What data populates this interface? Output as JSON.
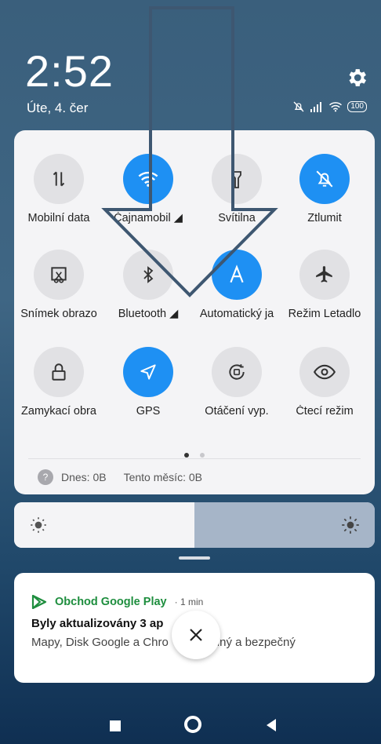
{
  "status": {
    "time": "2:52",
    "date": "Úte, 4. čer",
    "battery": "100",
    "icons": [
      "mute-icon",
      "signal-icon",
      "wifi-icon"
    ]
  },
  "quick_settings": [
    {
      "label": "Mobilní data",
      "icon": "mobile-data-icon",
      "active": false
    },
    {
      "label": "Čajnamobil ◢",
      "icon": "wifi-icon",
      "active": true
    },
    {
      "label": "Svítilna",
      "icon": "flashlight-icon",
      "active": false
    },
    {
      "label": "Ztlumit",
      "icon": "mute-icon",
      "active": true
    },
    {
      "label": "Snímek obrazo",
      "icon": "screenshot-icon",
      "active": false
    },
    {
      "label": "Bluetooth ◢",
      "icon": "bluetooth-icon",
      "active": false
    },
    {
      "label": "Automatický ja",
      "icon": "auto-brightness-icon",
      "active": true
    },
    {
      "label": "Režim Letadlo",
      "icon": "airplane-icon",
      "active": false
    },
    {
      "label": "Zamykací obra",
      "icon": "lock-icon",
      "active": false
    },
    {
      "label": "GPS",
      "icon": "location-icon",
      "active": true
    },
    {
      "label": "Otáčení vyp.",
      "icon": "rotation-icon",
      "active": false
    },
    {
      "label": "Čtecí režim",
      "icon": "eye-icon",
      "active": false
    }
  ],
  "data_usage": {
    "today": "Dnes: 0B",
    "month": "Tento měsíc: 0B"
  },
  "brightness": {
    "level": 0.5
  },
  "notification": {
    "app": "Obchod Google Play",
    "time": "· 1 min",
    "title": "Byly aktualizovány 3 ap",
    "body": "Mapy, Disk Google a Chro",
    "body_tail": "lný a bezpečný"
  },
  "colors": {
    "accent": "#1e90f3",
    "play_green": "#1e8e3e"
  }
}
